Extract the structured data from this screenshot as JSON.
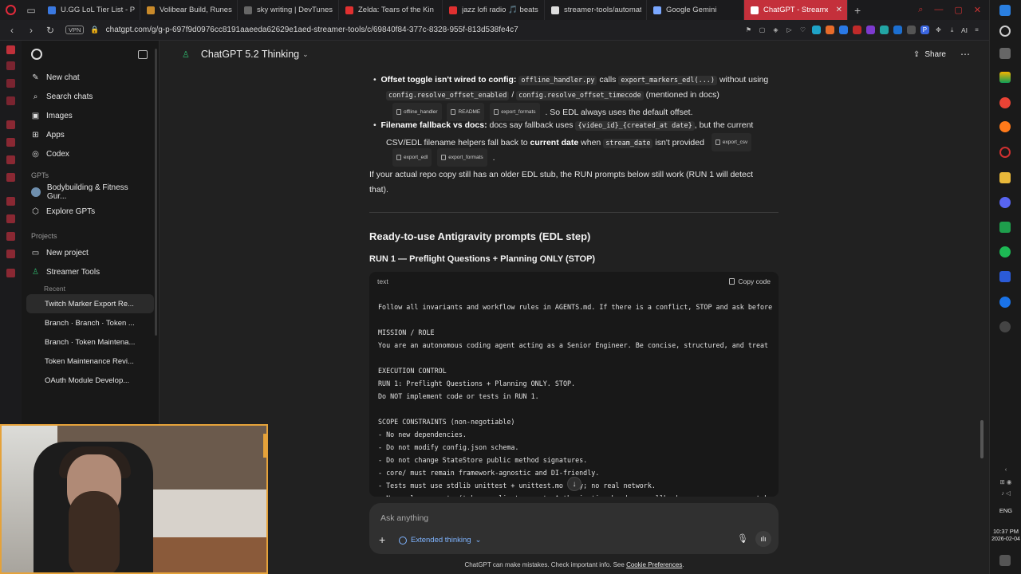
{
  "browser": {
    "tabs": [
      {
        "label": "U.GG LoL Tier List - Patch",
        "color": "#3a78e0"
      },
      {
        "label": "Volibear Build, Runes & C",
        "color": "#c98a2a"
      },
      {
        "label": "sky writing | DevTunes FM",
        "color": "#666666"
      },
      {
        "label": "Zelda: Tears of the Kin",
        "color": "#e03030"
      },
      {
        "label": "jazz lofi radio 🎵 beats to",
        "color": "#e03030"
      },
      {
        "label": "streamer-tools/automatic",
        "color": "#dddddd"
      },
      {
        "label": "Google Gemini",
        "color": "#7aa7ff"
      },
      {
        "label": "ChatGPT - Streamer Tools",
        "color": "#ffffff",
        "active": true
      }
    ],
    "vpn": "VPN",
    "url": "chatgpt.com/g/g-p-697f9d0976cc8191aaeeda62629e1aed-streamer-tools/c/69840f84-377c-8328-955f-813d538fe4c7",
    "ai_label": "AI"
  },
  "sidebar": {
    "items": [
      {
        "icon": "✎",
        "label": "New chat"
      },
      {
        "icon": "⌕",
        "label": "Search chats"
      },
      {
        "icon": "▣",
        "label": "Images"
      },
      {
        "icon": "⊞",
        "label": "Apps"
      },
      {
        "icon": "◎",
        "label": "Codex"
      }
    ],
    "gpts_label": "GPTs",
    "gpts": [
      {
        "label": "Bodybuilding & Fitness Gur..."
      },
      {
        "label": "Explore GPTs"
      }
    ],
    "projects_label": "Projects",
    "projects": [
      {
        "label": "New project"
      },
      {
        "label": "Streamer Tools"
      }
    ],
    "recent_label": "Recent",
    "recent": [
      {
        "label": "Twitch Marker Export Re..."
      },
      {
        "label": "Branch · Branch · Token ..."
      },
      {
        "label": "Branch · Token Maintena..."
      },
      {
        "label": "Token Maintenance Revi..."
      },
      {
        "label": "OAuth Module Develop..."
      }
    ]
  },
  "header": {
    "title": "ChatGPT 5.2 Thinking",
    "share_label": "Share"
  },
  "content": {
    "b1_title": "Offset toggle isn't wired to config:",
    "b1_code1": "offline_handler.py",
    "b1_calls": "calls",
    "b1_code2": "export_markers_edl(...)",
    "b1_without": "without using",
    "b1_code3": "config.resolve_offset_enabled",
    "b1_slash": "/",
    "b1_code4": "config.resolve_offset_timecode",
    "b1_mention": "(mentioned in docs)",
    "b1_cites": [
      "offline_handler",
      "README",
      "export_formats"
    ],
    "b1_tail": ". So EDL always uses the default offset.",
    "b2_title": "Filename fallback vs docs:",
    "b2_text1": "docs say fallback uses",
    "b2_code1": "{video_id}_{created_at date}",
    "b2_text2": ", but the current",
    "b2_text3": "CSV/EDL filename helpers fall back to",
    "b2_bold": "current date",
    "b2_when": "when",
    "b2_code2": "stream_date",
    "b2_text4": "isn't provided",
    "b2_cite_inline": "export_csv",
    "b2_cites": [
      "export_edl",
      "export_formats"
    ],
    "b2_period": ".",
    "para": "If your actual repo copy still has an older EDL stub, the RUN prompts below still work (RUN 1 will detect that).",
    "h2": "Ready-to-use Antigravity prompts (EDL step)",
    "h3": "RUN 1 — Preflight Questions + Planning ONLY (STOP)"
  },
  "codeblock": {
    "lang": "text",
    "copy_label": "Copy code",
    "lines": [
      "Follow all invariants and workflow rules in AGENTS.md. If there is a conflict, STOP and ask before",
      "",
      "MISSION / ROLE",
      "You are an autonomous coding agent acting as a Senior Engineer. Be concise, structured, and treat",
      "",
      "EXECUTION CONTROL",
      "RUN 1: Preflight Questions + Planning ONLY. STOP.",
      "Do NOT implement code or tests in RUN 1.",
      "",
      "SCOPE CONSTRAINTS (non-negotiable)",
      "- No new dependencies.",
      "- Do not modify config.json schema.",
      "- Do not change StateStore public method signatures.",
      "- core/ must remain framework-agnostic and DI-friendly.",
      "- Tests must use stdlib unittest + unittest.mo  nly; no real network.",
      "- Never log secrets (tokens, client_secret, Authorization headers, callback query params, raw toke"
    ]
  },
  "composer": {
    "placeholder": "Ask anything",
    "thinking_label": "Extended thinking"
  },
  "footer": {
    "disclaimer": "ChatGPT can make mistakes. Check important info. See",
    "link": "Cookie Preferences",
    "period": "."
  },
  "taskbar": {
    "lang": "ENG",
    "time": "10:37 PM",
    "date": "2026-02-04"
  }
}
